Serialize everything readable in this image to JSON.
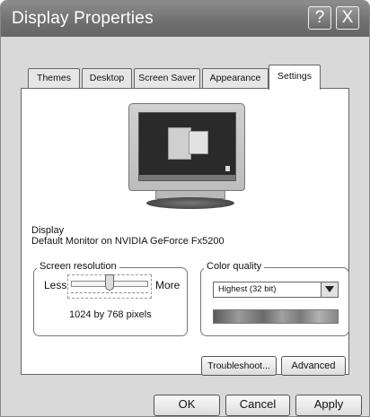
{
  "window": {
    "title": "Display Properties",
    "help_label": "?",
    "close_label": "X"
  },
  "tabs": [
    {
      "label": "Themes",
      "active": false
    },
    {
      "label": "Desktop",
      "active": false
    },
    {
      "label": "Screen Saver",
      "active": false
    },
    {
      "label": "Appearance",
      "active": false
    },
    {
      "label": "Settings",
      "active": true
    }
  ],
  "display": {
    "heading": "Display",
    "device": "Default Monitor on NVIDIA GeForce Fx5200"
  },
  "resolution": {
    "legend": "Screen resolution",
    "less_label": "Less",
    "more_label": "More",
    "value_text": "1024 by 768 pixels",
    "slider_level": 0.5
  },
  "color_quality": {
    "legend": "Color quality",
    "selected": "Highest (32 bit)"
  },
  "buttons": {
    "troubleshoot": "Troubleshoot...",
    "advanced": "Advanced",
    "ok": "OK",
    "cancel": "Cancel",
    "apply": "Apply"
  }
}
